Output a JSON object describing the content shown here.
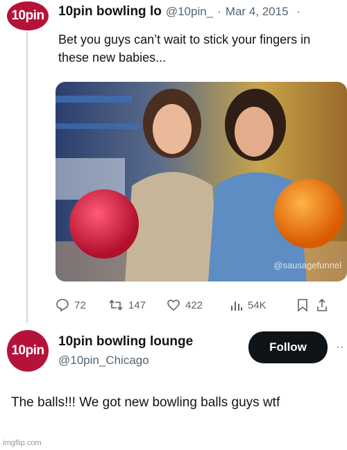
{
  "tweet1": {
    "avatar_text": "10pin",
    "display_name": "10pin bowling lo",
    "handle": "@10pin_",
    "separator": "·",
    "date": "Mar 4, 2015",
    "more": "·",
    "text": "Bet you guys can’t wait to stick your fingers in these new babies...",
    "media_watermark": "@sausagefunnel",
    "stats": {
      "replies": "72",
      "retweets": "147",
      "likes": "422",
      "views": "54K"
    },
    "icons": [
      "reply-icon",
      "retweet-icon",
      "like-icon",
      "views-icon",
      "bookmark-icon",
      "share-icon"
    ]
  },
  "tweet2": {
    "avatar_text": "10pin",
    "display_name": "10pin bowling lounge",
    "handle": "@10pin_Chicago",
    "follow_label": "Follow",
    "more": "··",
    "text": "The balls!!! We got new bowling balls guys wtf"
  },
  "footer": {
    "watermark": "imgflip.com"
  },
  "colors": {
    "avatar_bg": "#b5123a",
    "follow_bg": "#0f1419",
    "muted": "#536471"
  }
}
